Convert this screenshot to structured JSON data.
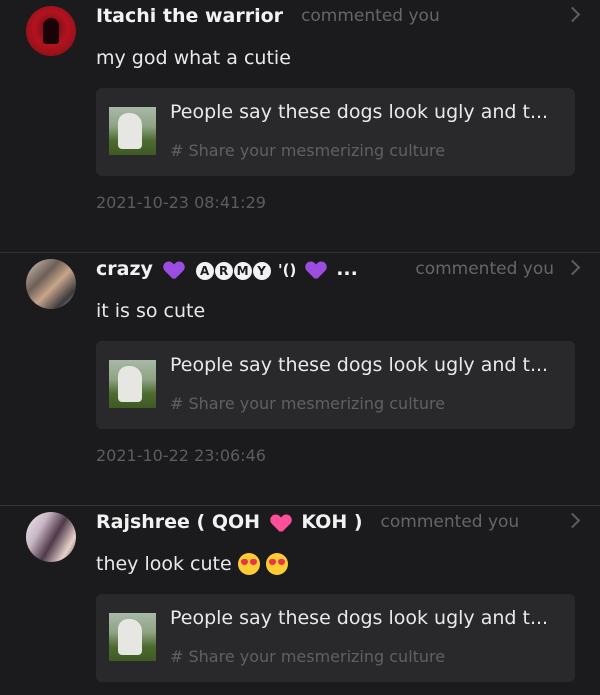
{
  "notifications": [
    {
      "user": "Itachi the warrior",
      "action": "commented you",
      "comment": "my god  what a cutie",
      "post_title": "People say these dogs look ugly and t...",
      "post_tag": "# Share your mesmerizing culture",
      "timestamp": "2021-10-23 08:41:29"
    },
    {
      "user_prefix": "crazy",
      "user_letters": [
        "A",
        "R",
        "M",
        "Y"
      ],
      "user_suffix": "'() ",
      "user_ellipsis": "...",
      "action": "commented you",
      "comment": "it is so cute",
      "post_title": "People say these dogs look ugly and t...",
      "post_tag": "# Share your mesmerizing culture",
      "timestamp": "2021-10-22 23:06:46"
    },
    {
      "user_prefix": "Rajshree ( QOH",
      "user_suffix": "KOH )",
      "action": "commented you",
      "comment": "they look cute",
      "post_title": "People say these dogs look ugly and t...",
      "post_tag": "# Share your mesmerizing culture"
    }
  ],
  "icons": {
    "chevron": "chevron-right-icon",
    "heart_purple": "purple-heart-emoji",
    "heart_pink": "pink-heart-emoji",
    "emoji_heart_eyes": "heart-eyes-emoji"
  },
  "colors": {
    "background": "#1b1b1d",
    "card": "#29292b",
    "muted_text": "#66666a"
  }
}
